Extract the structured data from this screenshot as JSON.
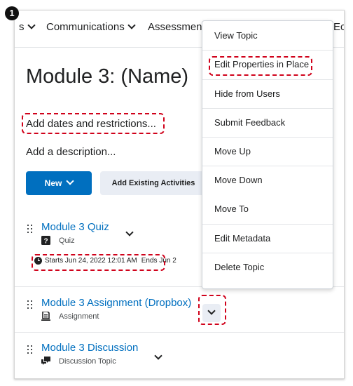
{
  "step_badge": "1",
  "nav": {
    "items": [
      {
        "label": "s"
      },
      {
        "label": "Communications"
      },
      {
        "label": "Assessment"
      },
      {
        "label": "Ec"
      }
    ]
  },
  "module": {
    "title": "Module 3: (Name)",
    "dates_link": "Add dates and restrictions...",
    "description_link": "Add a description..."
  },
  "actions": {
    "new_label": "New",
    "add_existing_label": "Add Existing Activities"
  },
  "topics": [
    {
      "title": "Module 3 Quiz",
      "type": "Quiz",
      "icon": "quiz-icon",
      "starts": "Starts Jun 24, 2022 12:01 AM",
      "ends": "Ends Jun 2"
    },
    {
      "title": "Module 3 Assignment (Dropbox)",
      "type": "Assignment",
      "icon": "assignment-icon"
    },
    {
      "title": "Module 3 Discussion",
      "type": "Discussion Topic",
      "icon": "discussion-icon"
    }
  ],
  "menu": {
    "items": [
      {
        "label": "View Topic"
      },
      {
        "label": "Edit Properties in Place"
      },
      {
        "label": "Hide from Users"
      },
      {
        "label": "Submit Feedback"
      },
      {
        "label": "Move Up"
      },
      {
        "label": "Move Down"
      },
      {
        "label": "Move To"
      },
      {
        "label": "Edit Metadata"
      },
      {
        "label": "Delete Topic"
      }
    ]
  },
  "colors": {
    "link": "#006fbf",
    "primary_button": "#006fbf",
    "secondary_button": "#e9edf4",
    "highlight_dash": "#d0021b"
  }
}
